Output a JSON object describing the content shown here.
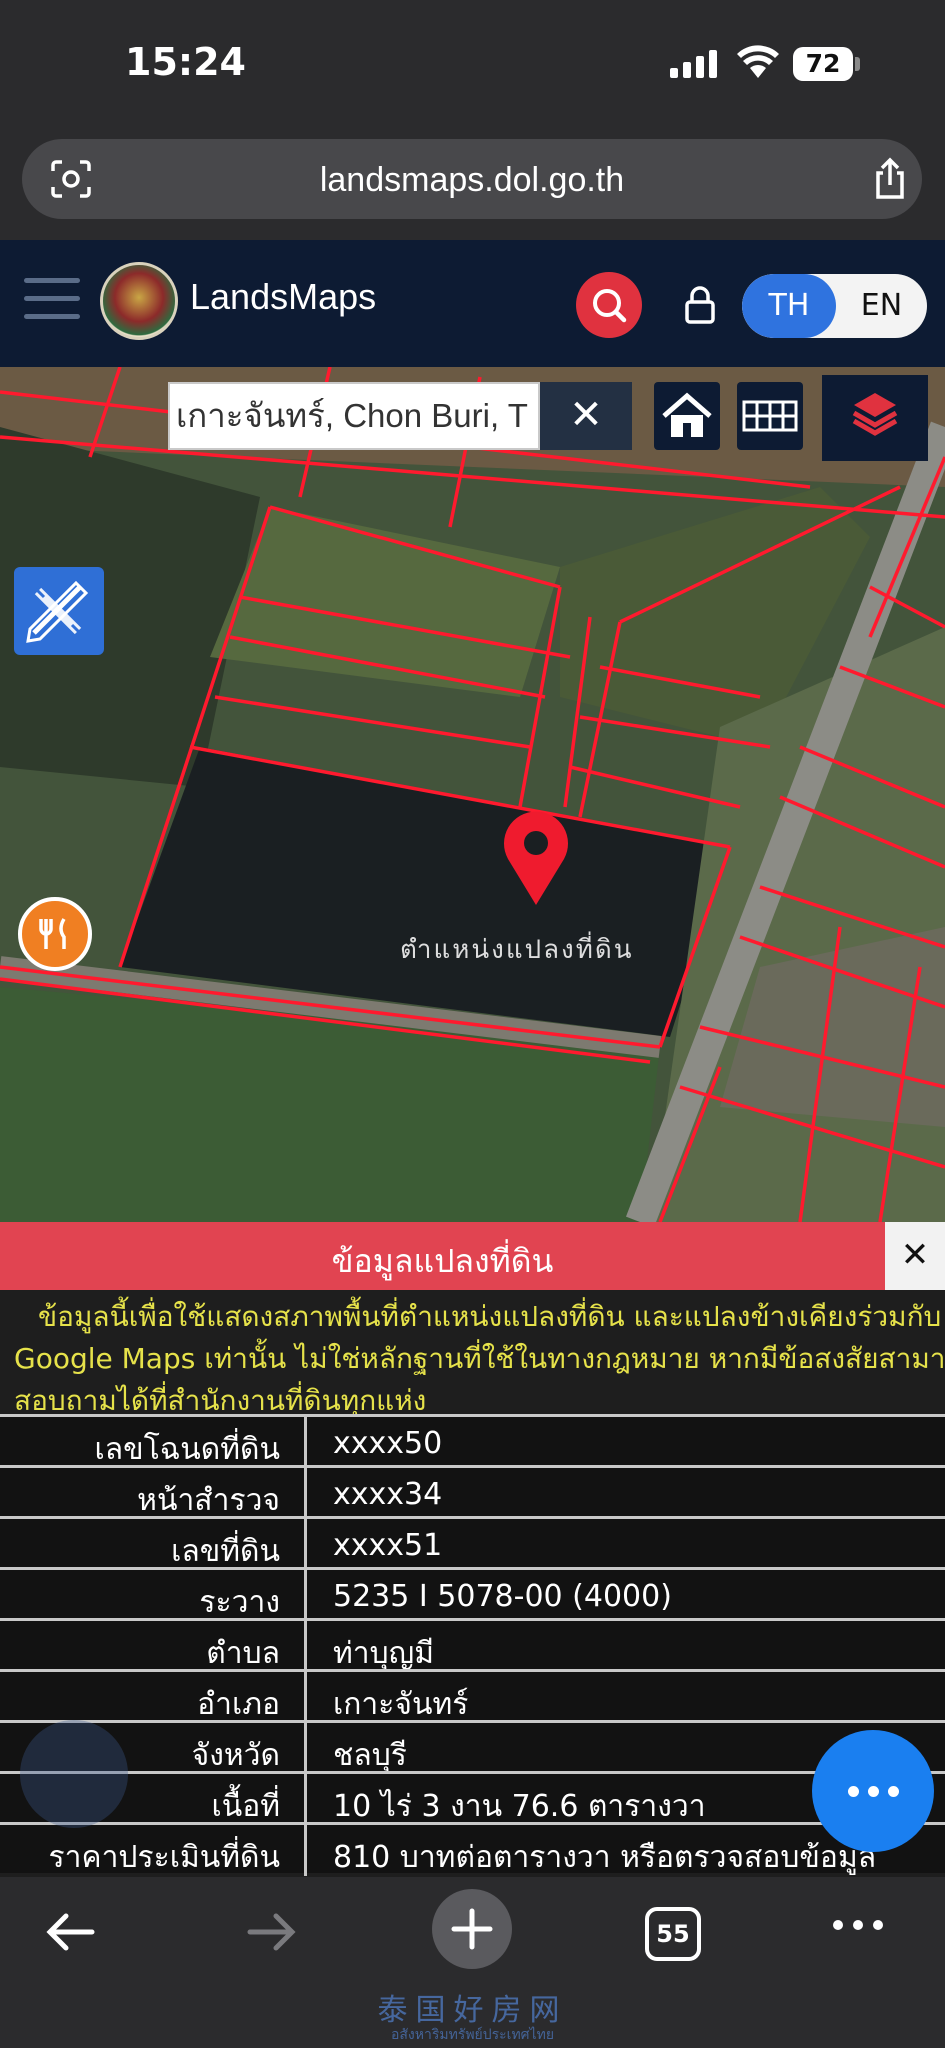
{
  "status_bar": {
    "time": "15:24",
    "battery": "72"
  },
  "browser": {
    "url": "landsmaps.dol.go.th",
    "tab_count": "55"
  },
  "app": {
    "brand": "LandsMaps",
    "lang_th": "TH",
    "lang_en": "EN"
  },
  "map": {
    "search": {
      "value": "เกาะจันทร์, Chon Buri, T"
    },
    "clear_label": "✕",
    "pin_label": "ตำแหน่งแปลงที่ดิน"
  },
  "panel": {
    "title": "ข้อมูลแปลงที่ดิน",
    "close_label": "✕",
    "disclaimer_lines": [
      "ข้อมูลนี้เพื่อใช้แสดงสภาพพื้นที่ตำแหน่งแปลงที่ดิน และแปลงข้างเคียงร่วมกับ",
      "Google Maps เท่านั้น ไม่ใช่หลักฐานที่ใช้ในทางกฎหมาย หากมีข้อสงสัยสามารถ",
      "สอบถามได้ที่สำนักงานที่ดินทุกแห่ง"
    ],
    "rows": [
      {
        "label": "เลขโฉนดที่ดิน",
        "value": "xxxx50"
      },
      {
        "label": "หน้าสำรวจ",
        "value": "xxxx34"
      },
      {
        "label": "เลขที่ดิน",
        "value": "xxxx51"
      },
      {
        "label": "ระวาง",
        "value": "5235 I 5078-00 (4000)"
      },
      {
        "label": "ตำบล",
        "value": "ท่าบุญมี"
      },
      {
        "label": "อำเภอ",
        "value": "เกาะจันทร์"
      },
      {
        "label": "จังหวัด",
        "value": "ชลบุรี"
      },
      {
        "label": "เนื้อที่",
        "value": "10 ไร่ 3 งาน 76.6 ตารางวา"
      },
      {
        "label": "ราคาประเมินที่ดิน",
        "value": "810 บาทต่อตารางวา หรือตรวจสอบข้อมูล"
      }
    ]
  },
  "watermark": {
    "title": "泰国好房网",
    "subtitle": "อสังหาริมทรัพย์ประเทศไทย"
  },
  "icons": {
    "lens": "lens-icon",
    "share": "share-icon",
    "menu": "hamburger-menu-icon",
    "search": "search-icon",
    "lock": "lock-icon",
    "home": "home-icon",
    "grid": "grid-icon",
    "layers": "layers-icon",
    "draw": "ruler-pencil-icon",
    "food": "restaurant-icon",
    "pin": "location-pin-icon",
    "more": "more-icon",
    "back": "arrow-left-icon",
    "forward": "arrow-right-icon",
    "new_tab": "plus-icon"
  },
  "colors": {
    "accent_red": "#e14451",
    "header_navy": "#0d1b33",
    "accent_blue": "#2f73df",
    "disclaimer_yellow": "#e6e24a"
  }
}
